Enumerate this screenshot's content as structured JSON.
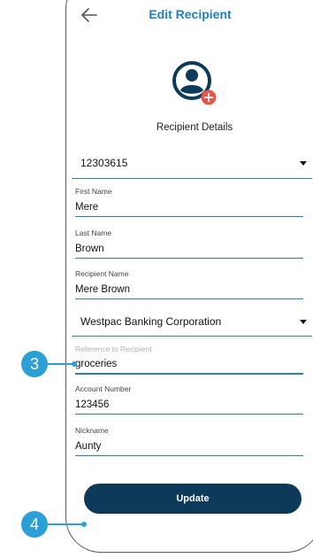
{
  "header": {
    "title": "Edit Recipient",
    "back_icon": "arrow-left-icon"
  },
  "avatar": {
    "icon": "user-avatar-icon",
    "badge_icon": "plus-badge-icon",
    "badge_color": "#e8554a"
  },
  "section_label": "Recipient Details",
  "account_select": {
    "value": "12303615"
  },
  "fields": {
    "first_name": {
      "label": "First Name",
      "value": "Mere"
    },
    "last_name": {
      "label": "Last Name",
      "value": "Brown"
    },
    "recipient_name": {
      "label": "Recipient Name",
      "value": "Mere Brown"
    },
    "reference": {
      "label": "Reference to Recipient",
      "value": "groceries"
    },
    "account_number": {
      "label": "Account Number",
      "value": "123456"
    },
    "nickname": {
      "label": "Nickname",
      "value": "Aunty"
    }
  },
  "bank_select": {
    "value": "Westpac Banking Corporation"
  },
  "update_button": {
    "label": "Update"
  },
  "callouts": [
    {
      "number": "3"
    },
    {
      "number": "4"
    }
  ],
  "colors": {
    "title": "#1f7fc0",
    "underline": "#2d7fb5",
    "button": "#0e3a5a",
    "callout": "#2b9fd6"
  }
}
